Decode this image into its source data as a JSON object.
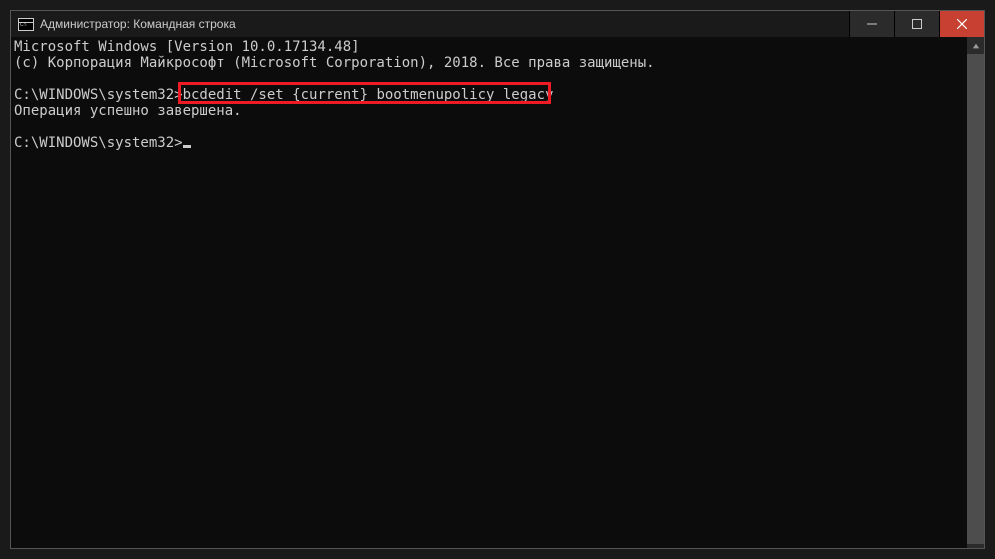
{
  "window": {
    "title": "Администратор: Командная строка"
  },
  "terminal": {
    "line1": "Microsoft Windows [Version 10.0.17134.48]",
    "line2": "(c) Корпорация Майкрософт (Microsoft Corporation), 2018. Все права защищены.",
    "prompt1_path": "C:\\WINDOWS\\system32>",
    "command1": "bcdedit /set {current} bootmenupolicy legacy",
    "result1": "Операция успешно завершена.",
    "prompt2_path": "C:\\WINDOWS\\system32>"
  },
  "colors": {
    "highlight": "#ed1c24",
    "close": "#c84031",
    "bg": "#0c0c0c",
    "fg": "#cccccc"
  }
}
